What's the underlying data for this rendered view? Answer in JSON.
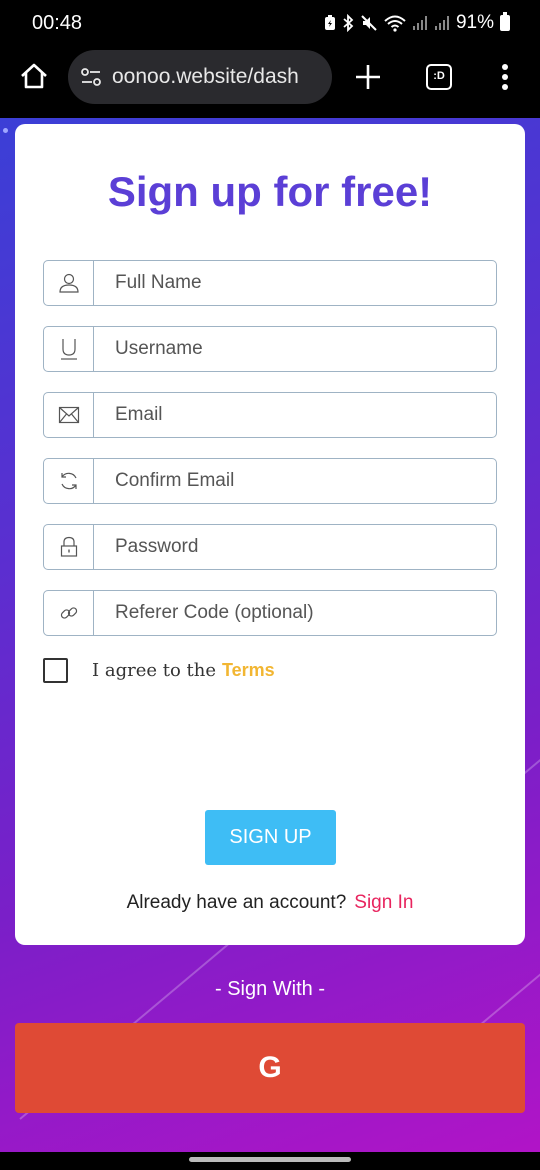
{
  "status_bar": {
    "time": "00:48",
    "battery": "91%",
    "icons": [
      "battery-saver-icon",
      "bluetooth-icon",
      "mute-icon",
      "wifi-icon",
      "signal-icon",
      "signal-icon-2",
      "battery-icon"
    ]
  },
  "browser": {
    "url": "oonoo.website/dash",
    "tab_label": ":D",
    "icons": [
      "home-icon",
      "site-settings-icon",
      "plus-icon",
      "tabs-icon",
      "more-vert-icon"
    ]
  },
  "form": {
    "title": "Sign up for free!",
    "fields": [
      {
        "placeholder": "Full Name",
        "icon": "user-icon"
      },
      {
        "placeholder": "Username",
        "icon": "underline-u-icon"
      },
      {
        "placeholder": "Email",
        "icon": "envelope-icon"
      },
      {
        "placeholder": "Confirm Email",
        "icon": "refresh-icon"
      },
      {
        "placeholder": "Password",
        "icon": "lock-icon"
      },
      {
        "placeholder": "Referer Code (optional)",
        "icon": "link-icon"
      }
    ],
    "agree_text": "I agree to the",
    "terms_link": "Terms",
    "submit_label": "SIGN UP",
    "already_text": "Already have an account?",
    "signin_link": "Sign In"
  },
  "social": {
    "sign_with": "- Sign With -",
    "google_label": "G"
  },
  "colors": {
    "title": "#5b3fd6",
    "submit_button": "#3ebdf5",
    "terms_link": "#f2b632",
    "signin_link": "#e8245e",
    "google_button": "#df4a35"
  }
}
